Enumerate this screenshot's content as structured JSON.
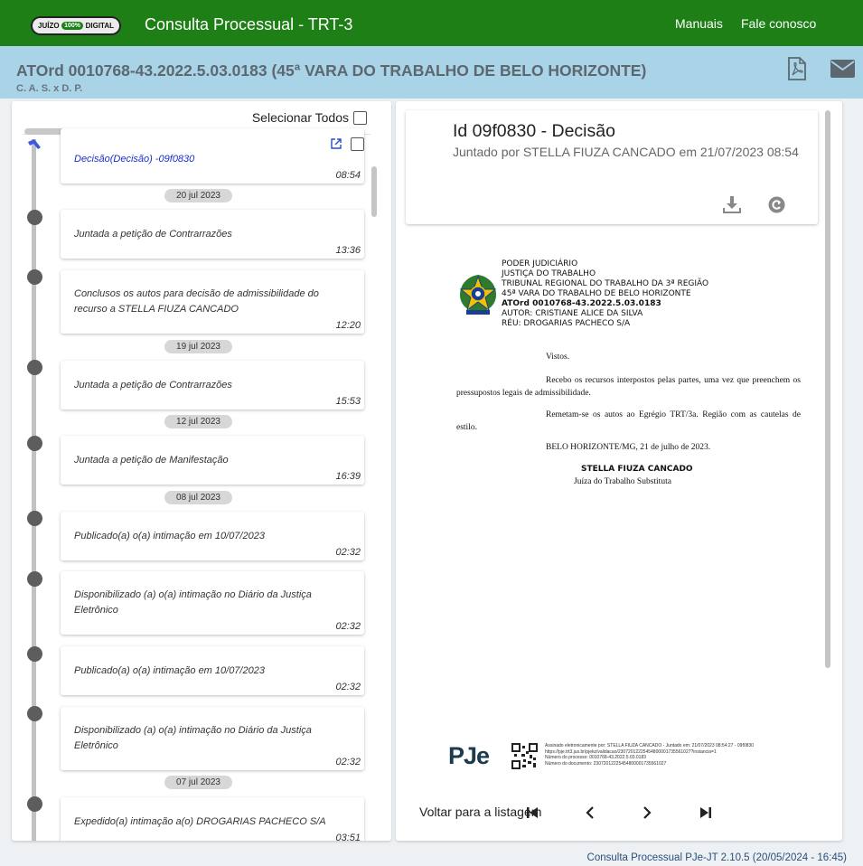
{
  "topbar": {
    "logo_left": "JUÍZO",
    "logo_badge": "100%",
    "logo_right": "DIGITAL",
    "title": "Consulta Processual - TRT-3",
    "links": [
      "Manuais",
      "Fale conosco"
    ]
  },
  "process": {
    "title": "ATOrd 0010768-43.2022.5.03.0183 (45ª VARA DO TRABALHO DE BELO HORIZONTE)",
    "parties": "C. A. S. x D. P."
  },
  "timeline": {
    "select_all_label": "Selecionar Todos",
    "events": [
      {
        "text": "Decisão(Decisão) -09f0830",
        "time": "08:54"
      },
      {
        "text": "Juntada a petição de Contrarrazões",
        "time": "13:36"
      },
      {
        "text": "Conclusos os autos para decisão de admissibilidade do recurso a STELLA FIUZA CANCADO",
        "time": "12:20"
      },
      {
        "text": "Juntada a petição de Contrarrazões",
        "time": "15:53"
      },
      {
        "text": "Juntada a petição de Manifestação",
        "time": "16:39"
      },
      {
        "text": "Publicado(a) o(a) intimação em 10/07/2023",
        "time": "02:32"
      },
      {
        "text": "Disponibilizado (a) o(a) intimação no Diário da Justiça Eletrônico",
        "time": "02:32"
      },
      {
        "text": "Publicado(a) o(a) intimação em 10/07/2023",
        "time": "02:32"
      },
      {
        "text": "Disponibilizado (a) o(a) intimação no Diário da Justiça Eletrônico",
        "time": "02:32"
      },
      {
        "text": "Expedido(a) intimação a(o) DROGARIAS PACHECO S/A",
        "time": "03:51"
      }
    ],
    "dates": [
      "20 jul 2023",
      "19 jul 2023",
      "12 jul 2023",
      "08 jul 2023",
      "07 jul 2023"
    ]
  },
  "document": {
    "title": "Id 09f0830 - Decisão",
    "subtitle": "Juntado por STELLA FIUZA CANCADO em 21/07/2023 08:54",
    "header_lines": [
      "PODER JUDICIÁRIO",
      "JUSTIÇA DO TRABALHO",
      "TRIBUNAL REGIONAL DO TRABALHO DA 3ª REGIÃO",
      "45ª VARA DO TRABALHO DE BELO HORIZONTE",
      "ATOrd 0010768-43.2022.5.03.0183",
      "AUTOR: CRISTIANE ALICE DA SILVA",
      "RÉU: DROGARIAS PACHECO S/A"
    ],
    "vistos": "Vistos.",
    "paragraph1": "Recebo os recursos interpostos pelas partes, uma vez que preenchem os pressupostos legais de admissibilidade.",
    "paragraph2": "Remetam-se os autos ao Egrégio TRT/3a. Região com as cautelas de estilo.",
    "place_date": "BELO HORIZONTE/MG, 21 de julho de 2023.",
    "signer": "STELLA FIUZA CANCADO",
    "signer_role": "Juíza do Trabalho Substituta",
    "pje_logo": "PJe",
    "signature_lines": [
      "Assinado eletronicamente por: STELLA FIUZA CANCADO - Juntado em: 21/07/2023 08:54:27 - 09f0830",
      "https://pje.trt3.jus.br/pjekz/validacao/23072012225454800001735561027?instancia=1",
      "Número do processo: 0010768-43.2022.5.03.0183",
      "Número do documento: 23072012225454800001735561027"
    ]
  },
  "navigation": {
    "back_label": "Voltar para a listagem"
  },
  "footer": {
    "version": "Consulta Processual PJe-JT 2.10.5 (20/05/2024 - 16:45)"
  }
}
